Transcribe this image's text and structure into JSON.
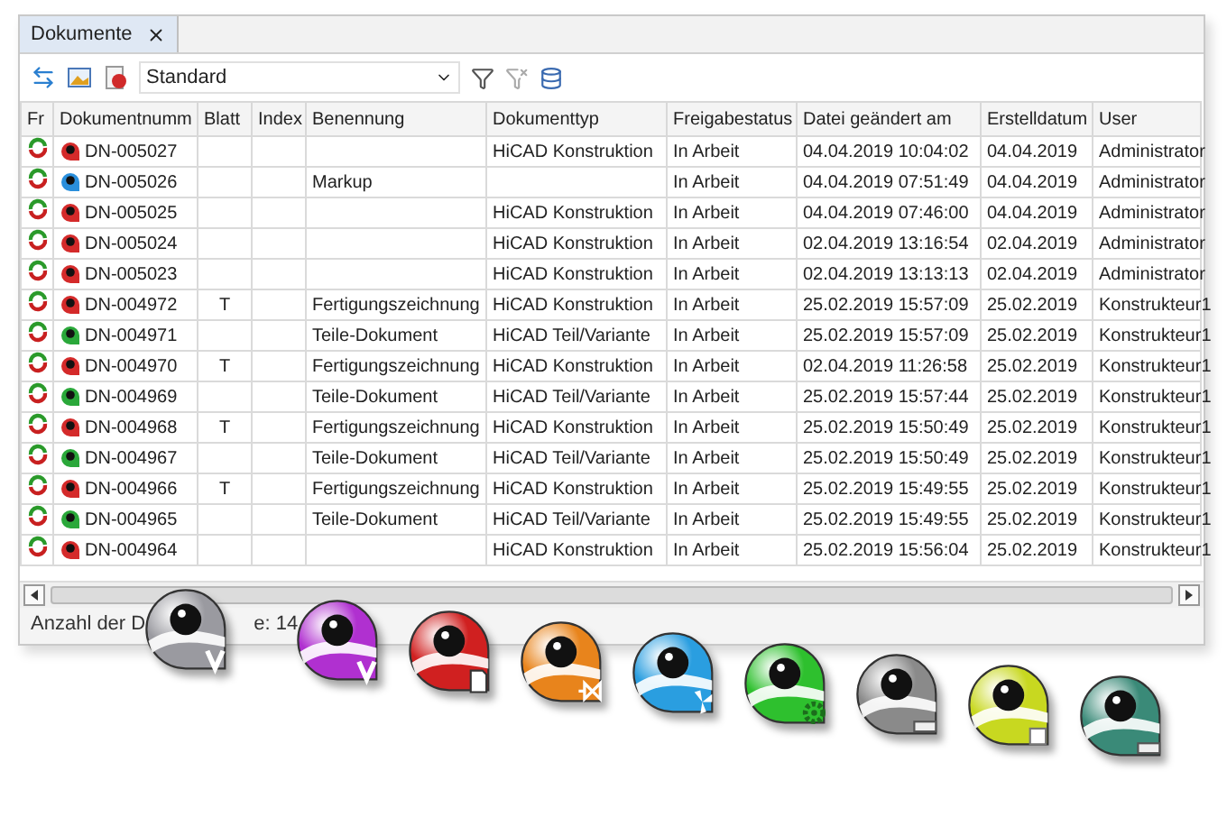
{
  "tab": {
    "label": "Dokumente",
    "selected": true
  },
  "toolbar": {
    "view_select": {
      "value": "Standard"
    }
  },
  "table": {
    "columns": [
      "Fr",
      "Dokumentnumm",
      "Blatt",
      "Index",
      "Benennung",
      "Dokumenttyp",
      "Freigabestatus",
      "Datei geändert am",
      "Erstelldatum",
      "User"
    ],
    "rows": [
      {
        "kind": "drawing",
        "number": "DN-005027",
        "sheet": "",
        "index": "",
        "name": "",
        "doc_type": "HiCAD Konstruktion",
        "status": "In Arbeit",
        "modified": "04.04.2019 10:04:02",
        "created": "04.04.2019",
        "user": "Administrator"
      },
      {
        "kind": "markup",
        "number": "DN-005026",
        "sheet": "",
        "index": "",
        "name": "Markup",
        "doc_type": "",
        "status": "In Arbeit",
        "modified": "04.04.2019 07:51:49",
        "created": "04.04.2019",
        "user": "Administrator"
      },
      {
        "kind": "drawing",
        "number": "DN-005025",
        "sheet": "",
        "index": "",
        "name": "",
        "doc_type": "HiCAD Konstruktion",
        "status": "In Arbeit",
        "modified": "04.04.2019 07:46:00",
        "created": "04.04.2019",
        "user": "Administrator"
      },
      {
        "kind": "drawing",
        "number": "DN-005024",
        "sheet": "",
        "index": "",
        "name": "",
        "doc_type": "HiCAD Konstruktion",
        "status": "In Arbeit",
        "modified": "02.04.2019 13:16:54",
        "created": "02.04.2019",
        "user": "Administrator"
      },
      {
        "kind": "drawing",
        "number": "DN-005023",
        "sheet": "",
        "index": "",
        "name": "",
        "doc_type": "HiCAD Konstruktion",
        "status": "In Arbeit",
        "modified": "02.04.2019 13:13:13",
        "created": "02.04.2019",
        "user": "Administrator"
      },
      {
        "kind": "drawing",
        "number": "DN-004972",
        "sheet": "T",
        "index": "",
        "name": "Fertigungszeichnung",
        "doc_type": "HiCAD Konstruktion",
        "status": "In Arbeit",
        "modified": "25.02.2019 15:57:09",
        "created": "25.02.2019",
        "user": "Konstrukteur1"
      },
      {
        "kind": "part",
        "number": "DN-004971",
        "sheet": "",
        "index": "",
        "name": "Teile-Dokument",
        "doc_type": "HiCAD Teil/Variante",
        "status": "In Arbeit",
        "modified": "25.02.2019 15:57:09",
        "created": "25.02.2019",
        "user": "Konstrukteur1"
      },
      {
        "kind": "drawing",
        "number": "DN-004970",
        "sheet": "T",
        "index": "",
        "name": "Fertigungszeichnung",
        "doc_type": "HiCAD Konstruktion",
        "status": "In Arbeit",
        "modified": "02.04.2019 11:26:58",
        "created": "25.02.2019",
        "user": "Konstrukteur1"
      },
      {
        "kind": "part",
        "number": "DN-004969",
        "sheet": "",
        "index": "",
        "name": "Teile-Dokument",
        "doc_type": "HiCAD Teil/Variante",
        "status": "In Arbeit",
        "modified": "25.02.2019 15:57:44",
        "created": "25.02.2019",
        "user": "Konstrukteur1"
      },
      {
        "kind": "drawing",
        "number": "DN-004968",
        "sheet": "T",
        "index": "",
        "name": "Fertigungszeichnung",
        "doc_type": "HiCAD Konstruktion",
        "status": "In Arbeit",
        "modified": "25.02.2019 15:50:49",
        "created": "25.02.2019",
        "user": "Konstrukteur1"
      },
      {
        "kind": "part",
        "number": "DN-004967",
        "sheet": "",
        "index": "",
        "name": "Teile-Dokument",
        "doc_type": "HiCAD Teil/Variante",
        "status": "In Arbeit",
        "modified": "25.02.2019 15:50:49",
        "created": "25.02.2019",
        "user": "Konstrukteur1"
      },
      {
        "kind": "drawing",
        "number": "DN-004966",
        "sheet": "T",
        "index": "",
        "name": "Fertigungszeichnung",
        "doc_type": "HiCAD Konstruktion",
        "status": "In Arbeit",
        "modified": "25.02.2019 15:49:55",
        "created": "25.02.2019",
        "user": "Konstrukteur1"
      },
      {
        "kind": "part",
        "number": "DN-004965",
        "sheet": "",
        "index": "",
        "name": "Teile-Dokument",
        "doc_type": "HiCAD Teil/Variante",
        "status": "In Arbeit",
        "modified": "25.02.2019 15:49:55",
        "created": "25.02.2019",
        "user": "Konstrukteur1"
      },
      {
        "kind": "drawing",
        "number": "DN-004964",
        "sheet": "",
        "index": "",
        "name": "",
        "doc_type": "HiCAD Konstruktion",
        "status": "In Arbeit",
        "modified": "25.02.2019 15:56:04",
        "created": "25.02.2019",
        "user": "Konstrukteur1"
      }
    ]
  },
  "status_bar": {
    "left": "Anzahl der D",
    "right": "e: 14"
  },
  "app_icons": [
    {
      "color": "#9a9aa0",
      "kind": "v"
    },
    {
      "color": "#b030d0",
      "kind": "v"
    },
    {
      "color": "#d02020",
      "kind": "doc"
    },
    {
      "color": "#e8841c",
      "kind": "valve"
    },
    {
      "color": "#2a9ee0",
      "kind": "fan"
    },
    {
      "color": "#2ec02e",
      "kind": "gear"
    },
    {
      "color": "#8a8a8a",
      "kind": "bar"
    },
    {
      "color": "#c8d820",
      "kind": "square"
    },
    {
      "color": "#3a8a78",
      "kind": "bar"
    }
  ]
}
